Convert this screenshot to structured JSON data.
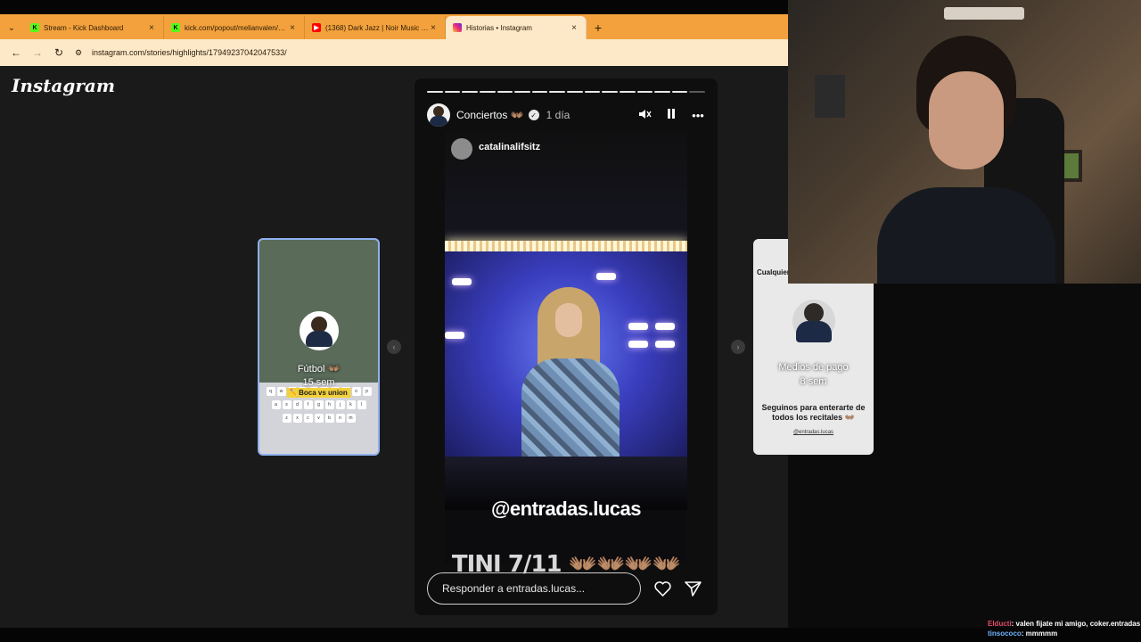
{
  "browser": {
    "tabs": [
      {
        "title": "Stream - Kick Dashboard",
        "icon": "kick-icon"
      },
      {
        "title": "kick.com/popout/melianvalen/chat",
        "icon": "kick-icon"
      },
      {
        "title": "(1368) Dark Jazz | Noir Music Saxophone",
        "icon": "youtube-icon"
      },
      {
        "title": "Historias • Instagram",
        "icon": "instagram-icon"
      }
    ],
    "url": "instagram.com/stories/highlights/17949237042047533/",
    "accent_color": "#f3a13c"
  },
  "instagram": {
    "logo": "Instagram",
    "prev_highlight": {
      "title": "Fútbol 👐🏽",
      "time": "15 sem",
      "badge": "✏️Boca vs union"
    },
    "next_highlight": {
      "title": "Medios de pago",
      "time": "8 sem",
      "top_text": "Cualquier d",
      "promo_text": "Seguinos para enterarte de todos los recitales 👐🏽",
      "handle": "@entradas.lucas"
    },
    "story": {
      "highlight_name": "Conciertos 👐🏽",
      "time": "1 día",
      "reposted_user": "catalinalifsitz",
      "overlay_handle": "@entradas.lucas",
      "caption": "TINI 7/11 👐🏽👐🏽👐🏽👐🏽",
      "reply_placeholder": "Responder a entradas.lucas...",
      "segments_total": 16,
      "segments_viewed": 15
    }
  },
  "chat": [
    {
      "user": "Elducti",
      "message": ": valen fijate mi amigo, coker.entradas"
    },
    {
      "user": "tinsococo",
      "message": ": mmmmm"
    }
  ]
}
